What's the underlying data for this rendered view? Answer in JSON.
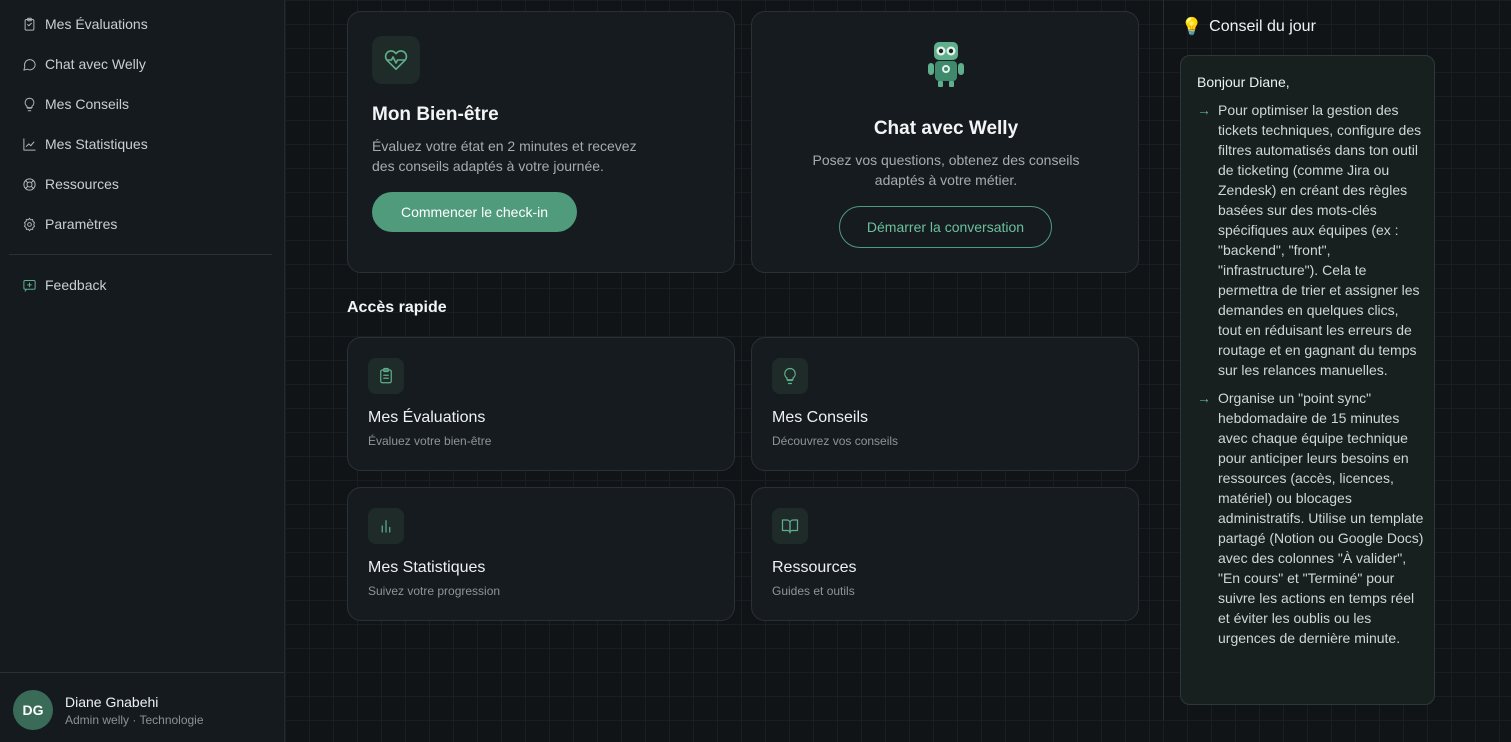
{
  "sidebar": {
    "items": [
      {
        "label": "Mes Évaluations",
        "icon": "clipboard-icon"
      },
      {
        "label": "Chat avec Welly",
        "icon": "chat-bubble-icon"
      },
      {
        "label": "Mes Conseils",
        "icon": "lightbulb-icon"
      },
      {
        "label": "Mes Statistiques",
        "icon": "line-chart-icon"
      },
      {
        "label": "Ressources",
        "icon": "lifebuoy-icon"
      },
      {
        "label": "Paramètres",
        "icon": "gear-icon"
      }
    ],
    "feedback": {
      "label": "Feedback",
      "icon": "message-plus-icon"
    },
    "user": {
      "initials": "DG",
      "name": "Diane Gnabehi",
      "role": "Admin welly · Technologie"
    }
  },
  "hero": {
    "wellbeing": {
      "title": "Mon Bien-être",
      "description": "Évaluez votre état en 2 minutes et recevez des conseils adaptés à votre journée.",
      "button": "Commencer le check-in"
    },
    "chat": {
      "title": "Chat avec Welly",
      "description": "Posez vos questions, obtenez des conseils adaptés à votre métier.",
      "button": "Démarrer la conversation"
    }
  },
  "quick_access": {
    "title": "Accès rapide",
    "cards": [
      {
        "title": "Mes Évaluations",
        "subtitle": "Évaluez votre bien-être",
        "icon": "clipboard-list-icon"
      },
      {
        "title": "Mes Conseils",
        "subtitle": "Découvrez vos conseils",
        "icon": "lightbulb-icon"
      },
      {
        "title": "Mes Statistiques",
        "subtitle": "Suivez votre progression",
        "icon": "bar-chart-icon"
      },
      {
        "title": "Ressources",
        "subtitle": "Guides et outils",
        "icon": "book-open-icon"
      }
    ]
  },
  "tip": {
    "header": "Conseil du jour",
    "greeting": "Bonjour Diane,",
    "items": [
      "Pour optimiser la gestion des tickets techniques, configure des filtres automatisés dans ton outil de ticketing (comme Jira ou Zendesk) en créant des règles basées sur des mots-clés spécifiques aux équipes (ex : \"backend\", \"front\", \"infrastructure\"). Cela te permettra de trier et assigner les demandes en quelques clics, tout en réduisant les erreurs de routage et en gagnant du temps sur les relances manuelles.",
      "Organise un \"point sync\" hebdomadaire de 15 minutes avec chaque équipe technique pour anticiper leurs besoins en ressources (accès, licences, matériel) ou blocages administratifs. Utilise un template partagé (Notion ou Google Docs) avec des colonnes \"À valider\", \"En cours\" et \"Terminé\" pour suivre les actions en temps réel et éviter les oublis ou les urgences de dernière minute."
    ]
  },
  "colors": {
    "accent": "#4f9b7c",
    "background": "#0f1316"
  }
}
